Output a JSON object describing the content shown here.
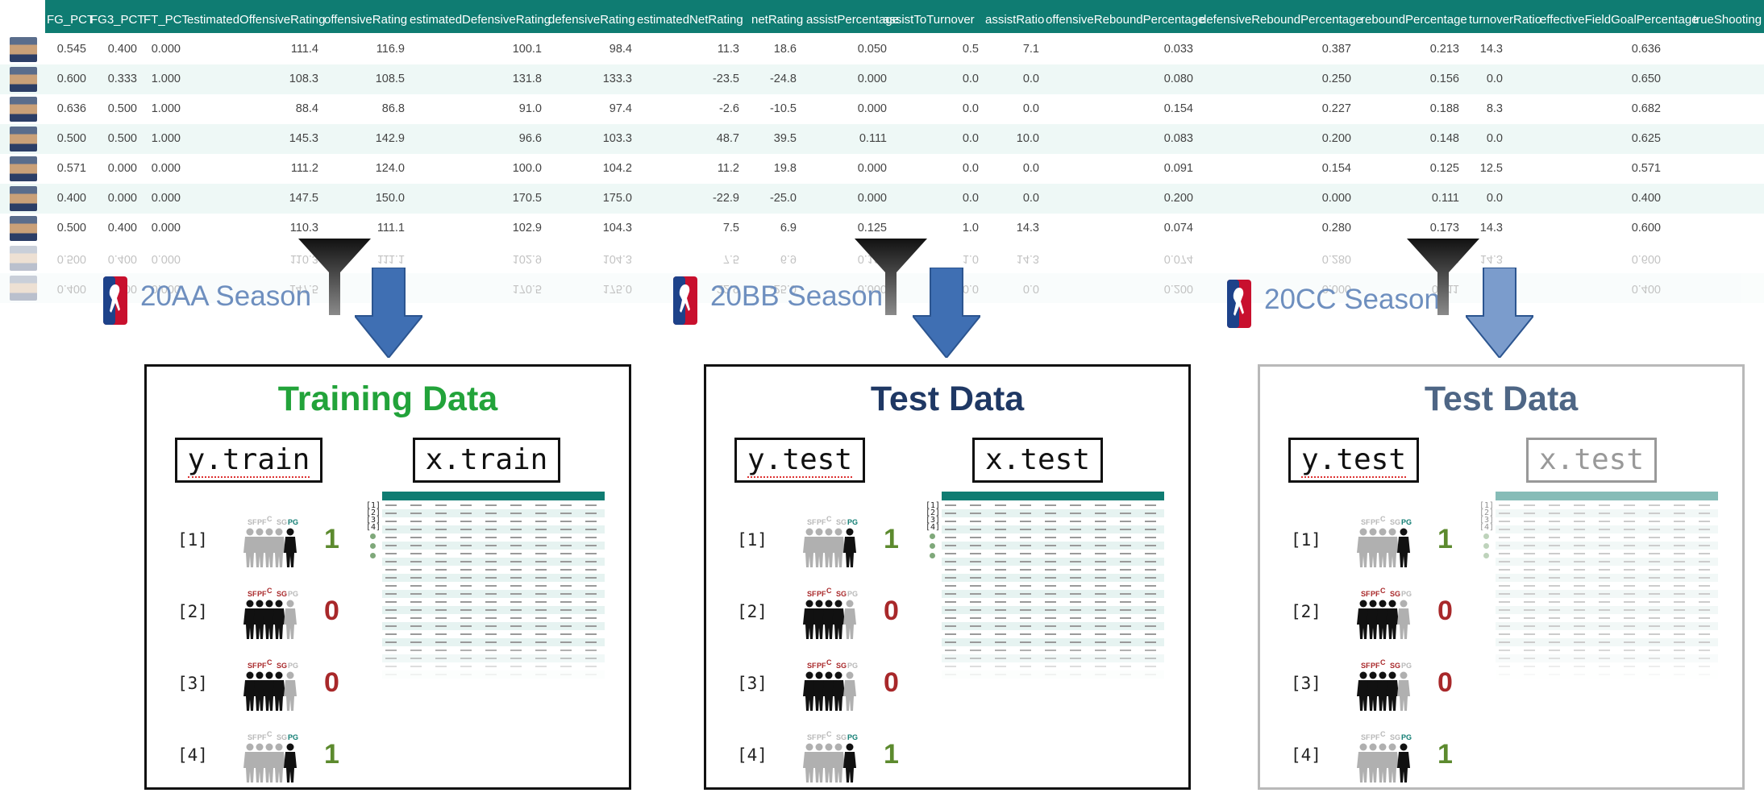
{
  "table": {
    "headers": [
      "FG_PCT",
      "FG3_PCT",
      "FT_PCT",
      "estimatedOffensiveRating",
      "offensiveRating",
      "estimatedDefensiveRating",
      "defensiveRating",
      "estimatedNetRating",
      "netRating",
      "assistPercentage",
      "assistToTurnover",
      "assistRatio",
      "offensiveReboundPercentage",
      "defensiveReboundPercentage",
      "reboundPercentage",
      "turnoverRatio",
      "effectiveFieldGoalPercentage",
      "trueShooting"
    ],
    "rows": [
      [
        "0.545",
        "0.400",
        "0.000",
        "111.4",
        "116.9",
        "100.1",
        "98.4",
        "11.3",
        "18.6",
        "0.050",
        "0.5",
        "7.1",
        "0.033",
        "0.387",
        "0.213",
        "14.3",
        "",
        "0.636"
      ],
      [
        "0.600",
        "0.333",
        "1.000",
        "108.3",
        "108.5",
        "131.8",
        "133.3",
        "-23.5",
        "-24.8",
        "0.000",
        "0.0",
        "0.0",
        "0.080",
        "0.250",
        "0.156",
        "0.0",
        "",
        "0.650"
      ],
      [
        "0.636",
        "0.500",
        "1.000",
        "88.4",
        "86.8",
        "91.0",
        "97.4",
        "-2.6",
        "-10.5",
        "0.000",
        "0.0",
        "0.0",
        "0.154",
        "0.227",
        "0.188",
        "8.3",
        "",
        "0.682"
      ],
      [
        "0.500",
        "0.500",
        "1.000",
        "145.3",
        "142.9",
        "96.6",
        "103.3",
        "48.7",
        "39.5",
        "0.111",
        "0.0",
        "10.0",
        "0.083",
        "0.200",
        "0.148",
        "0.0",
        "",
        "0.625"
      ],
      [
        "0.571",
        "0.000",
        "0.000",
        "111.2",
        "124.0",
        "100.0",
        "104.2",
        "11.2",
        "19.8",
        "0.000",
        "0.0",
        "0.0",
        "0.091",
        "0.154",
        "0.125",
        "12.5",
        "",
        "0.571"
      ],
      [
        "0.400",
        "0.000",
        "0.000",
        "147.5",
        "150.0",
        "170.5",
        "175.0",
        "-22.9",
        "-25.0",
        "0.000",
        "0.0",
        "0.0",
        "0.200",
        "0.000",
        "0.111",
        "0.0",
        "",
        "0.400"
      ],
      [
        "0.500",
        "0.400",
        "0.000",
        "110.3",
        "111.1",
        "102.9",
        "104.3",
        "7.5",
        "6.9",
        "0.125",
        "1.0",
        "14.3",
        "0.074",
        "0.280",
        "0.173",
        "14.3",
        "",
        "0.600"
      ]
    ],
    "faded_rows": [
      [
        "0.500",
        "0.400",
        "0.000",
        "110.3",
        "111.1",
        "102.9",
        "104.3",
        "7.5",
        "6.9",
        "0.125",
        "1.0",
        "14.3",
        "0.074",
        "0.280",
        "0.173",
        "14.3",
        "",
        "0.600"
      ],
      [
        "0.400",
        "0.000",
        "0.000",
        "147.5",
        "150.0",
        "170.5",
        "175.0",
        "-22.9",
        "-25.0",
        "0.000",
        "0.0",
        "0.0",
        "0.200",
        "0.000",
        "0.111",
        "0.0",
        "",
        "0.400"
      ]
    ]
  },
  "seasons": [
    {
      "label": "20AA Season"
    },
    {
      "label": "20BB Season"
    },
    {
      "label": "20CC Season"
    }
  ],
  "panels": [
    {
      "title": "Training Data",
      "title_color": "#22a33a",
      "y_label": "y.train",
      "x_label": "x.train",
      "light": false,
      "dot_suffix": true
    },
    {
      "title": "Test Data",
      "title_color": "#1f3864",
      "y_label": "y.test",
      "x_label": "x.test",
      "light": false,
      "dot_suffix": false
    },
    {
      "title": "Test Data",
      "title_color": "#4e6685",
      "y_label": "y.test",
      "x_label": "x.test",
      "light": true,
      "dot_suffix": false
    }
  ],
  "examples": [
    {
      "index": "[1]",
      "value": "1",
      "positions": [
        "SF",
        "PF",
        "C",
        "SG",
        "PG"
      ],
      "highlight": "PG"
    },
    {
      "index": "[2]",
      "value": "0",
      "positions": [
        "SF",
        "PF",
        "C",
        "SG",
        "PG"
      ],
      "highlight": "SF PF C SG"
    },
    {
      "index": "[3]",
      "value": "0",
      "positions": [
        "SF",
        "PF",
        "C",
        "SG",
        "PG"
      ],
      "highlight": "SF PF C SG"
    },
    {
      "index": "[4]",
      "value": "1",
      "positions": [
        "SF",
        "PF",
        "C",
        "SG",
        "PG"
      ],
      "highlight": "PG"
    }
  ],
  "mini_table": {
    "indices": [
      "[1]",
      "[2]",
      "[3]",
      "[4]"
    ],
    "header_color": "#0f7c72"
  },
  "colors": {
    "value_one": "#5c8a2e",
    "value_zero": "#a8282a",
    "position_highlight_pg": "#0f7c72",
    "position_highlight_front": "#a8282a",
    "position_muted": "#b8b8b8",
    "arrow_fill": "#3f6fb3",
    "funnel_fill": "#2b2b2b"
  }
}
